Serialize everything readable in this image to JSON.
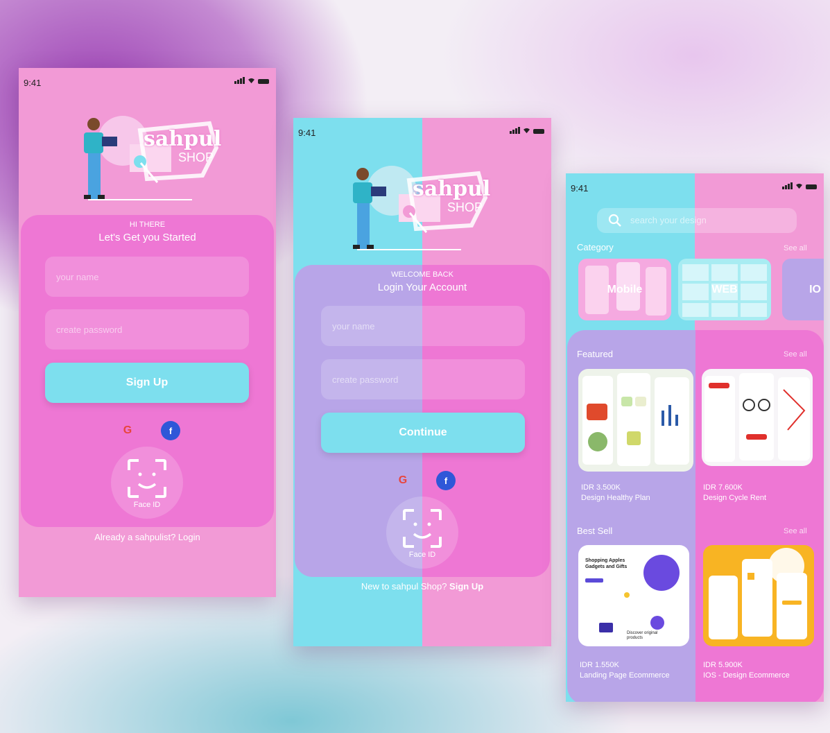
{
  "phone1": {
    "time": "9:41",
    "logo_main": "sahpul",
    "logo_sub": "SHOP",
    "greeting": "HI THERE",
    "subtitle": "Let's Get you Started",
    "name_placeholder": "your name",
    "password_placeholder": "create password",
    "cta_label": "Sign Up",
    "faceid_label": "Face ID",
    "footer": "Already a sahpulist? Login"
  },
  "phone2": {
    "time": "9:41",
    "logo_main": "sahpul",
    "logo_sub": "SHOP",
    "greeting": "WELCOME BACK",
    "subtitle": "Login Your Account",
    "name_placeholder": "your name",
    "password_placeholder": "create password",
    "cta_label": "Continue",
    "faceid_label": "Face ID",
    "footer_prefix": "New to sahpul Shop? ",
    "footer_link": "Sign Up"
  },
  "phone3": {
    "time": "9:41",
    "search_placeholder": "search your design",
    "category_title": "Category",
    "category_see_all": "See all",
    "categories": [
      "Mobile",
      "WEB",
      "IO"
    ],
    "featured_title": "Featured",
    "featured_see_all": "See all",
    "featured": [
      {
        "price": "IDR 3.500K",
        "name": "Design Healthy Plan"
      },
      {
        "price": "IDR 7.600K",
        "name": "Design Cycle Rent"
      }
    ],
    "bestsell_title": "Best Sell",
    "bestsell_see_all": "See all",
    "bestsell": [
      {
        "price": "IDR 1.550K",
        "name": "Landing Page Ecommerce"
      },
      {
        "price": "IDR 5.900K",
        "name": "IOS - Design Ecommerce"
      }
    ],
    "shot_texts": {
      "shopping_title": "Shopping Apples Gadgets and Gifts",
      "discover": "Discover original products"
    }
  },
  "colors": {
    "pink": "#f29ad6",
    "pink_card": "#ee77d4",
    "cyan": "#7ddfee",
    "lavender": "#b8a5e8"
  }
}
